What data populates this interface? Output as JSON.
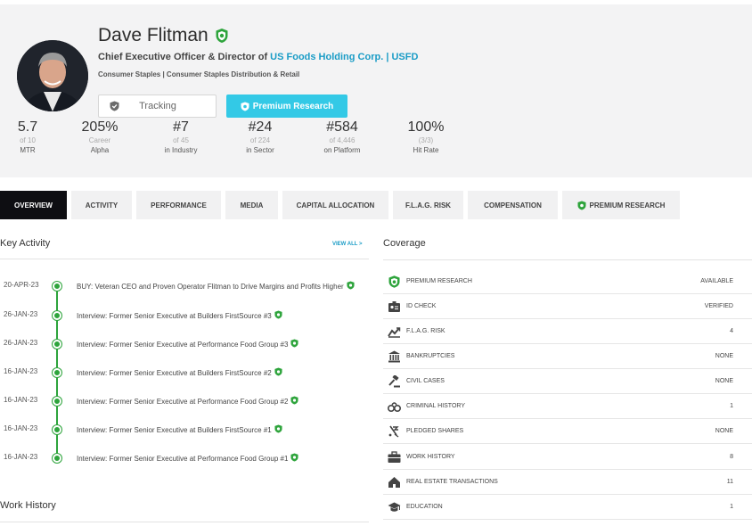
{
  "profile": {
    "name": "Dave Flitman",
    "title_prefix": "Chief Executive Officer & Director of",
    "company_link": "US Foods Holding Corp. | USFD",
    "sector": "Consumer Staples | Consumer Staples Distribution & Retail",
    "tracking_label": "Tracking",
    "premium_label": "Premium Research"
  },
  "stats": [
    {
      "value": "5.7",
      "sub1": "of 10",
      "sub2": "MTR"
    },
    {
      "value": "205%",
      "sub1": "Career",
      "sub2": "Alpha"
    },
    {
      "value": "#7",
      "sub1": "of 45",
      "sub2": "in Industry"
    },
    {
      "value": "#24",
      "sub1": "of 224",
      "sub2": "in Sector"
    },
    {
      "value": "#584",
      "sub1": "of 4,446",
      "sub2": "on Platform"
    },
    {
      "value": "100%",
      "sub1": "(3/3)",
      "sub2": "Hit Rate"
    }
  ],
  "tabs": [
    "OVERVIEW",
    "ACTIVITY",
    "PERFORMANCE",
    "MEDIA",
    "CAPITAL ALLOCATION",
    "F.L.A.G. RISK",
    "COMPENSATION",
    "PREMIUM RESEARCH"
  ],
  "key_activity": {
    "title": "Key Activity",
    "view_all": "VIEW ALL >",
    "items": [
      {
        "date": "20-APR-23",
        "text": "BUY: Veteran CEO and Proven Operator Flitman to Drive Margins and Profits Higher"
      },
      {
        "date": "26-JAN-23",
        "text": "Interview: Former Senior Executive at Builders FirstSource #3"
      },
      {
        "date": "26-JAN-23",
        "text": "Interview: Former Senior Executive at Performance Food Group #3"
      },
      {
        "date": "16-JAN-23",
        "text": "Interview: Former Senior Executive at Builders FirstSource #2"
      },
      {
        "date": "16-JAN-23",
        "text": "Interview: Former Senior Executive at Performance Food Group #2"
      },
      {
        "date": "16-JAN-23",
        "text": "Interview: Former Senior Executive at Builders FirstSource #1"
      },
      {
        "date": "16-JAN-23",
        "text": "Interview: Former Senior Executive at Performance Food Group #1"
      }
    ]
  },
  "work_history": {
    "title": "Work History"
  },
  "coverage": {
    "title": "Coverage",
    "rows": [
      {
        "icon": "premium-shield-icon",
        "label": "PREMIUM RESEARCH",
        "value": "AVAILABLE"
      },
      {
        "icon": "id-card-icon",
        "label": "ID CHECK",
        "value": "VERIFIED"
      },
      {
        "icon": "flag-risk-icon",
        "label": "F.L.A.G. RISK",
        "value": "4"
      },
      {
        "icon": "bank-icon",
        "label": "BANKRUPTCIES",
        "value": "NONE"
      },
      {
        "icon": "gavel-icon",
        "label": "CIVIL CASES",
        "value": "NONE"
      },
      {
        "icon": "handcuffs-icon",
        "label": "CRIMINAL HISTORY",
        "value": "1"
      },
      {
        "icon": "pledged-shares-icon",
        "label": "PLEDGED SHARES",
        "value": "NONE"
      },
      {
        "icon": "briefcase-icon",
        "label": "WORK HISTORY",
        "value": "8"
      },
      {
        "icon": "house-icon",
        "label": "REAL ESTATE TRANSACTIONS",
        "value": "11"
      },
      {
        "icon": "graduation-cap-icon",
        "label": "EDUCATION",
        "value": "1"
      }
    ]
  },
  "colors": {
    "accent": "#33c9e6",
    "link": "#1a9cc6",
    "timeline": "#2ea43c",
    "active_tab": "#0e0e12"
  }
}
